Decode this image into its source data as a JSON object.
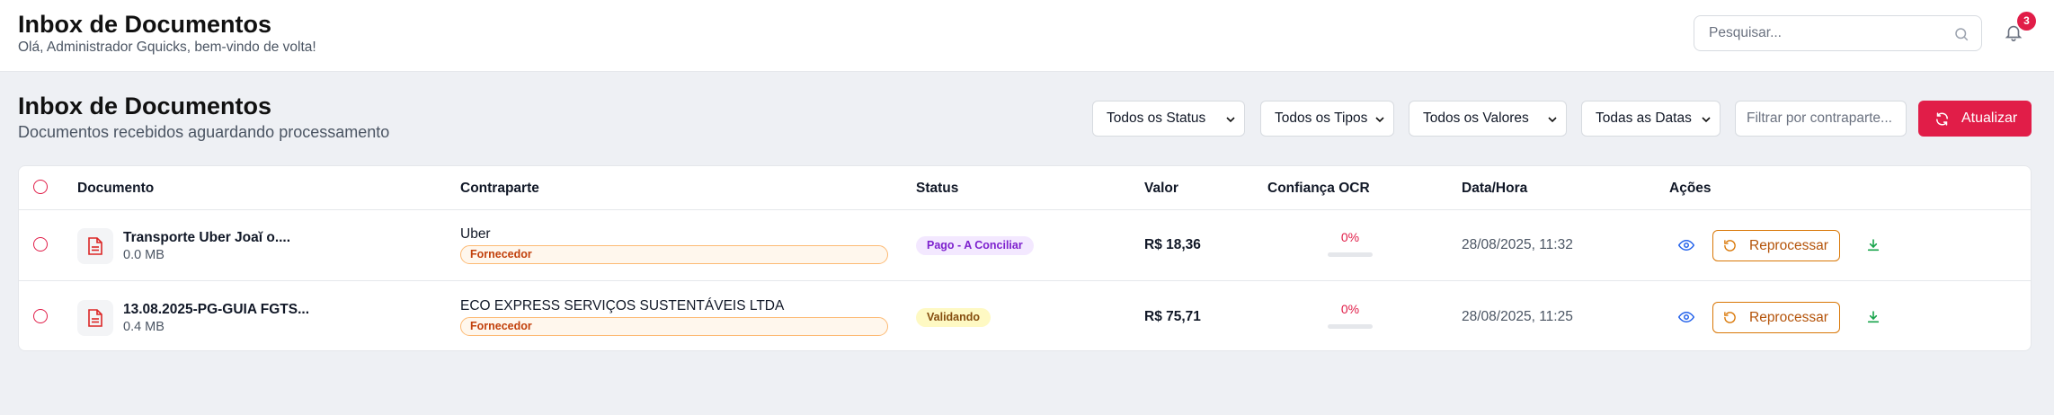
{
  "header": {
    "app_title": "Inbox de Documentos",
    "greeting": "Olá, Administrador Gquicks, bem-vindo de volta!",
    "search_placeholder": "Pesquisar...",
    "notifications_count": "3"
  },
  "page": {
    "title": "Inbox de Documentos",
    "subtitle": "Documentos recebidos aguardando processamento"
  },
  "filters": {
    "status": "Todos os Status",
    "types": "Todos os Tipos",
    "values": "Todos os Valores",
    "dates": "Todas as Datas",
    "counterparty_placeholder": "Filtrar por contraparte...",
    "refresh_label": "Atualizar"
  },
  "table": {
    "columns": [
      "Documento",
      "Contraparte",
      "Status",
      "Valor",
      "Confiança OCR",
      "Data/Hora",
      "Ações"
    ],
    "rows": [
      {
        "doc_name": "Transporte Uber Joaĭ      o....",
        "doc_size": "0.0 MB",
        "counterparty": "Uber",
        "counterparty_type": "Fornecedor",
        "status": "Pago - A Conciliar",
        "value": "R$ 18,36",
        "ocr": "0%",
        "ocr_fraction": 0,
        "datetime": "28/08/2025, 11:32",
        "action_label": "Reprocessar"
      },
      {
        "doc_name": "13.08.2025-PG-GUIA FGTS...",
        "doc_size": "0.4 MB",
        "counterparty": "ECO EXPRESS SERVIÇOS SUSTENTÁVEIS LTDA",
        "counterparty_type": "Fornecedor",
        "status": "Validando",
        "value": "R$ 75,71",
        "ocr": "0%",
        "ocr_fraction": 0,
        "datetime": "28/08/2025, 11:25",
        "action_label": "Reprocessar"
      }
    ]
  },
  "colors": {
    "accent": "#e11d48",
    "reprocess": "#d97706",
    "eye": "#2563eb",
    "download": "#16a34a"
  }
}
